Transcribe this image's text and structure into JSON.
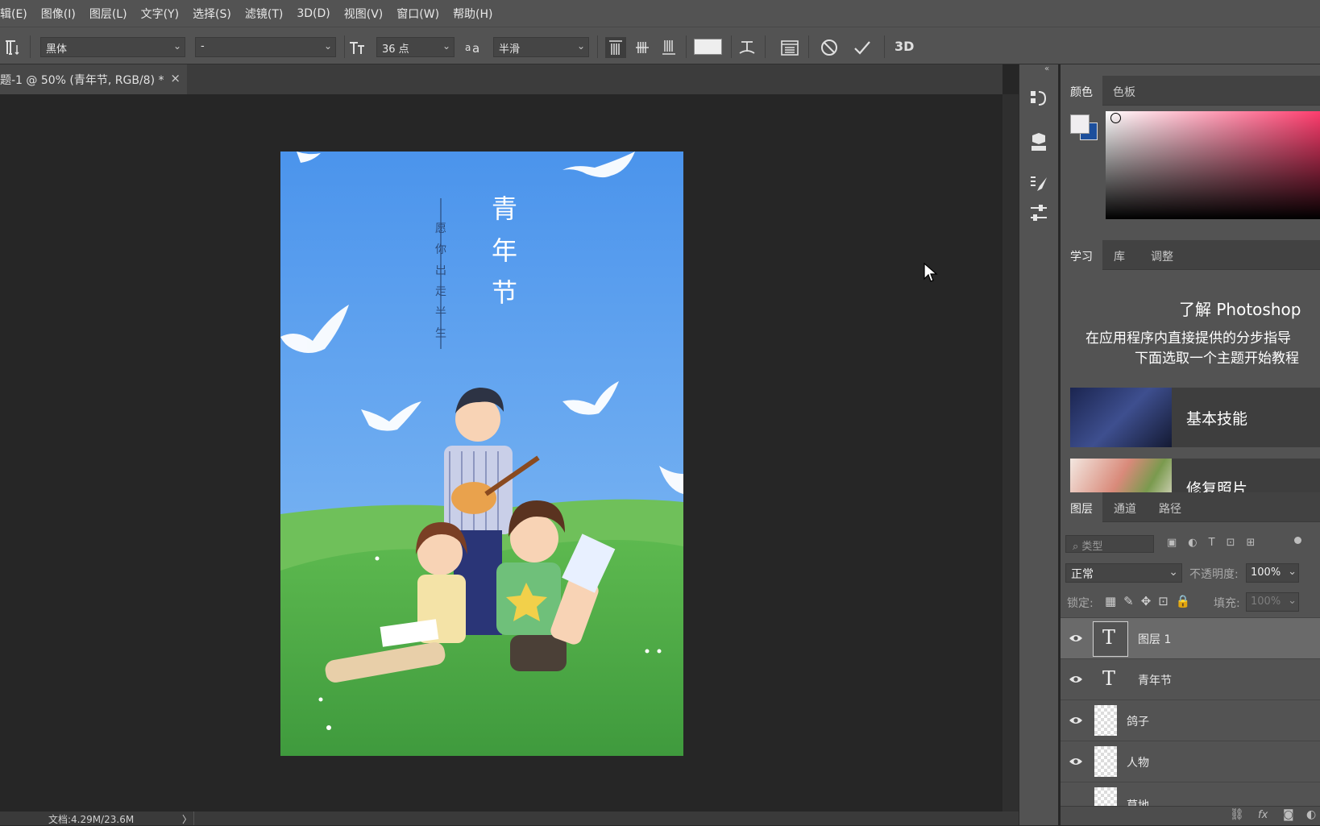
{
  "menu": [
    "辑(E)",
    "图像(I)",
    "图层(L)",
    "文字(Y)",
    "选择(S)",
    "滤镜(T)",
    "3D(D)",
    "视图(V)",
    "窗口(W)",
    "帮助(H)"
  ],
  "options": {
    "font_family": "黑体",
    "font_style": "-",
    "font_size": "36 点",
    "anti_alias": "半滑",
    "three_d": "3D"
  },
  "document_tab": {
    "title": "题-1 @ 50% (青年节, RGB/8) *",
    "close": "×"
  },
  "artwork": {
    "title_chars": [
      "青",
      "年",
      "节"
    ],
    "subtitle_chars": [
      "愿",
      "你",
      "出",
      "走",
      "半",
      "生"
    ]
  },
  "status": {
    "doc": "文档:4.29M/23.6M",
    "arrow": "〉"
  },
  "color_panel": {
    "tabs": [
      "颜色",
      "色板"
    ],
    "foreground": "#f0eef0",
    "background": "#1c4f9c",
    "hue": "#ff3d6e"
  },
  "learn_panel": {
    "tabs": [
      "学习",
      "库",
      "调整"
    ],
    "heading": "了解 Photoshop",
    "line1": "在应用程序内直接提供的分步指导",
    "line2": "下面选取一个主题开始教程",
    "cards": [
      {
        "label": "基本技能"
      },
      {
        "label": "修复照片"
      }
    ]
  },
  "layers_panel": {
    "tabs": [
      "图层",
      "通道",
      "路径"
    ],
    "filter_placeholder": "类型",
    "blend_mode": "正常",
    "opacity_label": "不透明度:",
    "opacity_value": "100%",
    "lock_label": "锁定:",
    "fill_label": "填充:",
    "fill_value": "100%",
    "layers": [
      {
        "name": "图层 1",
        "kind": "text",
        "selected": true
      },
      {
        "name": "青年节",
        "kind": "text",
        "selected": false
      },
      {
        "name": "鸽子",
        "kind": "smart",
        "selected": false
      },
      {
        "name": "人物",
        "kind": "smart",
        "selected": false
      },
      {
        "name": "草地",
        "kind": "smart",
        "selected": false
      }
    ],
    "footer_icons": [
      "link-icon",
      "fx-icon",
      "mask-icon",
      "adjustment-icon"
    ],
    "fx": "fx"
  },
  "colors": {
    "ui_bg": "#535353",
    "workspace": "#262626",
    "sky": "#4d95ec",
    "grass": "#4aa846"
  }
}
